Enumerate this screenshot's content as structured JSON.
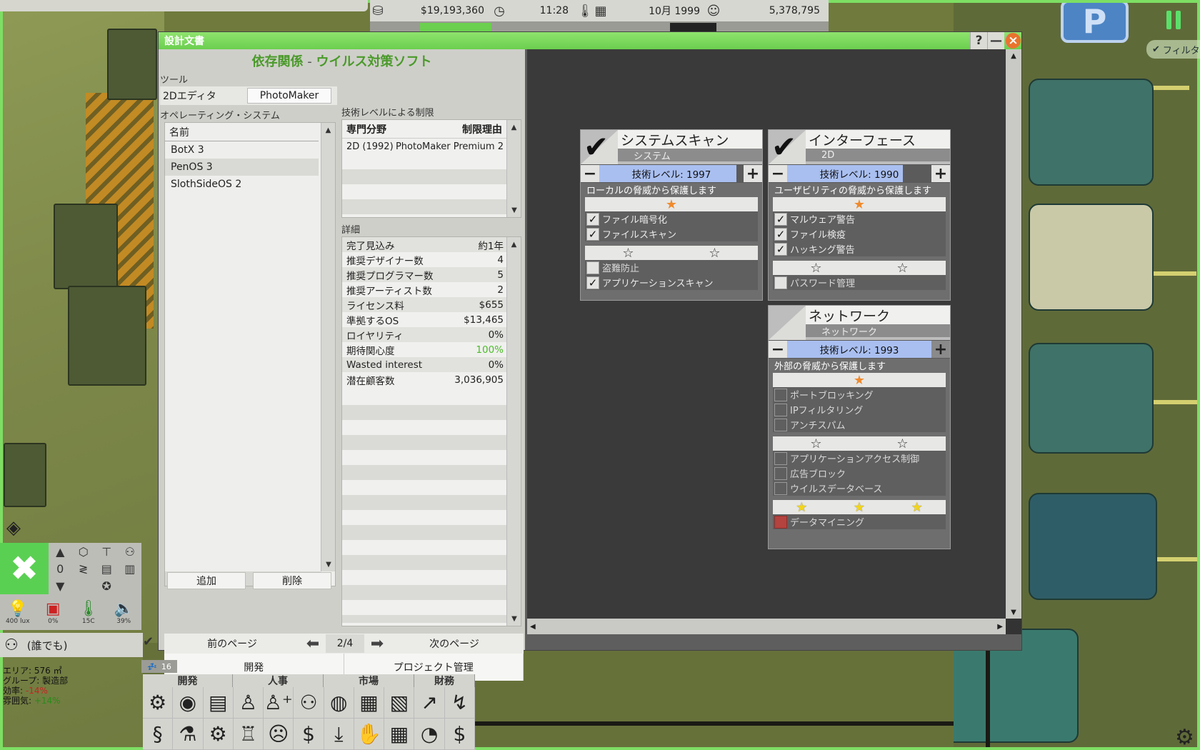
{
  "topbar": {
    "money": "$19,193,360",
    "time": "11:28",
    "date": "10月 1999",
    "fans": "5,378,795"
  },
  "filter_label": "フィルタ",
  "window": {
    "title": "設計文書",
    "help": "?",
    "minimize": "—",
    "close": "×"
  },
  "header": {
    "title": "依存関係",
    "separator": " - ",
    "subtitle": "ウイルス対策ソフト"
  },
  "tools": {
    "label": "ツール",
    "row_label": "2Dエディタ",
    "row_value": "PhotoMaker"
  },
  "os": {
    "label": "オペレーティング・システム",
    "column": "名前",
    "items": [
      "BotX 3",
      "PenOS 3",
      "SlothSideOS 2"
    ],
    "selected_index": 1,
    "add": "追加",
    "delete": "削除"
  },
  "tech_limits": {
    "label": "技術レベルによる制限",
    "col1": "専門分野",
    "col2": "制限理由",
    "rows": [
      {
        "field": "2D (1992)",
        "reason": "PhotoMaker Premium 2"
      }
    ]
  },
  "details": {
    "label": "詳細",
    "rows": [
      {
        "k": "完了見込み",
        "v": "約1年"
      },
      {
        "k": "推奨デザイナー数",
        "v": "4"
      },
      {
        "k": "推奨プログラマー数",
        "v": "5"
      },
      {
        "k": "推奨アーティスト数",
        "v": "2"
      },
      {
        "k": "ライセンス料",
        "v": "$655"
      },
      {
        "k": "準拠するOS",
        "v": "$13,465"
      },
      {
        "k": "ロイヤリティ",
        "v": "0%"
      },
      {
        "k": "期待関心度",
        "v": "100%"
      },
      {
        "k": "Wasted interest",
        "v": "0%"
      },
      {
        "k": "潜在顧客数",
        "v": "3,036,905"
      }
    ]
  },
  "nav": {
    "prev": "前のページ",
    "page": "2/4",
    "next": "次のページ",
    "develop": "開発",
    "project": "プロジェクト管理"
  },
  "features": {
    "system_scan": {
      "title": "システムスキャン",
      "category": "システム",
      "level": "技術レベル: 1997",
      "desc": "ローカルの脅威から保護します",
      "items_t1": [
        {
          "label": "ファイル暗号化",
          "checked": true
        },
        {
          "label": "ファイルスキャン",
          "checked": true
        }
      ],
      "items_t2": [
        {
          "label": "盗難防止",
          "checked": false
        },
        {
          "label": "アプリケーションスキャン",
          "checked": true
        }
      ]
    },
    "interface": {
      "title": "インターフェース",
      "category": "2D",
      "level": "技術レベル: 1990",
      "desc": "ユーザビリティの脅威から保護します",
      "items_t1": [
        {
          "label": "マルウェア警告",
          "checked": true
        },
        {
          "label": "ファイル検疫",
          "checked": true
        },
        {
          "label": "ハッキング警告",
          "checked": true
        }
      ],
      "items_t2": [
        {
          "label": "パスワード管理",
          "checked": false
        }
      ]
    },
    "network": {
      "title": "ネットワーク",
      "category": "ネットワーク",
      "level": "技術レベル: 1993",
      "desc": "外部の脅威から保護します",
      "items_t1": [
        {
          "label": "ポートブロッキング",
          "checked": false
        },
        {
          "label": "IPフィルタリング",
          "checked": false
        },
        {
          "label": "アンチスパム",
          "checked": false
        }
      ],
      "items_t2": [
        {
          "label": "アプリケーションアクセス制御",
          "checked": false
        },
        {
          "label": "広告ブロック",
          "checked": false
        },
        {
          "label": "ウイルスデータベース",
          "checked": false
        }
      ],
      "items_t3": [
        {
          "label": "データマイニング",
          "checked": false,
          "locked": true
        }
      ]
    }
  },
  "hud": {
    "light": "400 lux",
    "art": "0%",
    "temp": "15C",
    "noise": "39%",
    "level_zero": "0",
    "who": "(誰でも)",
    "queue": "16",
    "area": "エリア: 576 ㎡",
    "group": "グループ: 製造部",
    "efficiency_label": "効率: ",
    "efficiency": "-14%",
    "atmosphere_label": "雰囲気: ",
    "atmosphere": "+14%"
  },
  "bottom_menu": {
    "groups": [
      "開発",
      "人事",
      "市場",
      "財務"
    ]
  },
  "colors": {
    "accent_green": "#6bcf4f",
    "level_bar": "#a9bff0",
    "star_orange": "#ef8a2d",
    "star_yellow": "#f2d51d"
  }
}
